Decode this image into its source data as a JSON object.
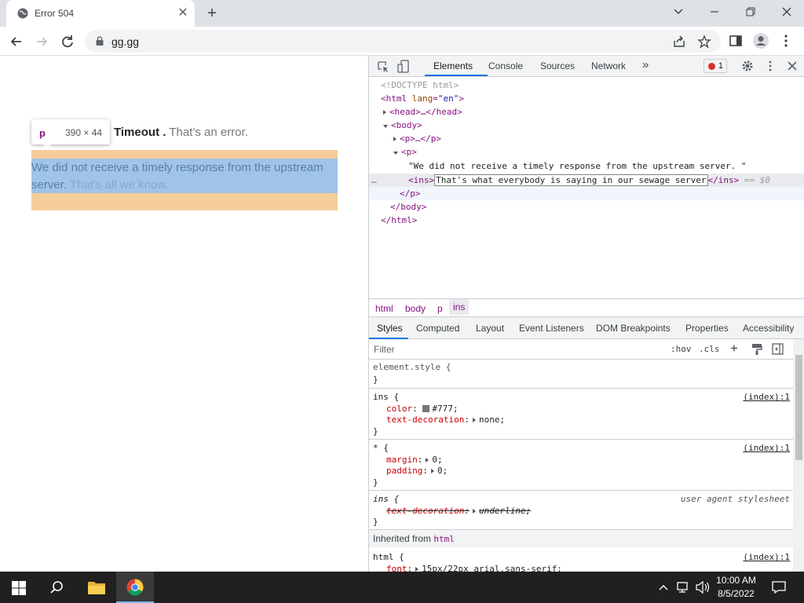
{
  "browser": {
    "tab_title": "Error 504",
    "new_tab": "+",
    "url": "gg.gg"
  },
  "page": {
    "tooltip_tag": "p",
    "tooltip_size": "390 × 44",
    "heading_bold": "Timeout .",
    "heading_rest": "That’s an error.",
    "para_text": "We did not receive a timely response from the upstream server.",
    "para_ins": "That’s all we know."
  },
  "devtools": {
    "tabs": [
      "Elements",
      "Console",
      "Sources",
      "Network"
    ],
    "more": "»",
    "error_count": "1",
    "dom": {
      "doctype": "<!DOCTYPE html>",
      "html_open_tag": "<html",
      "html_attr": "lang",
      "html_attr_val": "\"en\"",
      "head": "<head>…</head>",
      "body_open": "<body>",
      "p_collapsed": "<p>…</p>",
      "p_open": "<p>",
      "text_node": "\"We did not receive a timely response from the upstream server. \"",
      "ins_open": "<ins>",
      "ins_edit_text": "That's what everybody is saying in our sewage server",
      "ins_close": "</ins>",
      "dollar": "== $0",
      "p_close": "</p>",
      "body_close": "</body>",
      "html_close": "</html>",
      "ellipsis": "…"
    },
    "breadcrumbs": [
      "html",
      "body",
      "p",
      "ins"
    ],
    "style_tabs": [
      "Styles",
      "Computed",
      "Layout",
      "Event Listeners",
      "DOM Breakpoints",
      "Properties",
      "Accessibility"
    ],
    "filter_placeholder": "Filter",
    "hov": ":hov",
    "cls": ".cls",
    "rules": {
      "element_style": "element.style {",
      "close": "}",
      "ins_selector": "ins {",
      "ins_src": "(index):1",
      "color_prop": "color",
      "color_val": "#777;",
      "textdec_prop": "text-decoration",
      "textdec_val": "none;",
      "star_selector": "* {",
      "star_src": "(index):1",
      "margin_prop": "margin",
      "margin_val": "0;",
      "padding_prop": "padding",
      "padding_val": "0;",
      "ua_selector": "ins {",
      "ua_label": "user agent stylesheet",
      "ua_prop": "text-decoration",
      "ua_val": "underline;",
      "inherited_label": "Inherited from",
      "inherited_tag": "html",
      "html_selector": "html {",
      "html_src": "(index):1",
      "font_prop": "font",
      "font_val": "15px/22px arial,sans-serif;"
    }
  },
  "taskbar": {
    "time": "10:00 AM",
    "date": "8/5/2022"
  },
  "colors": {
    "margin_highlight": "#f6cc9a",
    "content_highlight": "#9fc3e9",
    "devtools_accent": "#1a73e8"
  }
}
